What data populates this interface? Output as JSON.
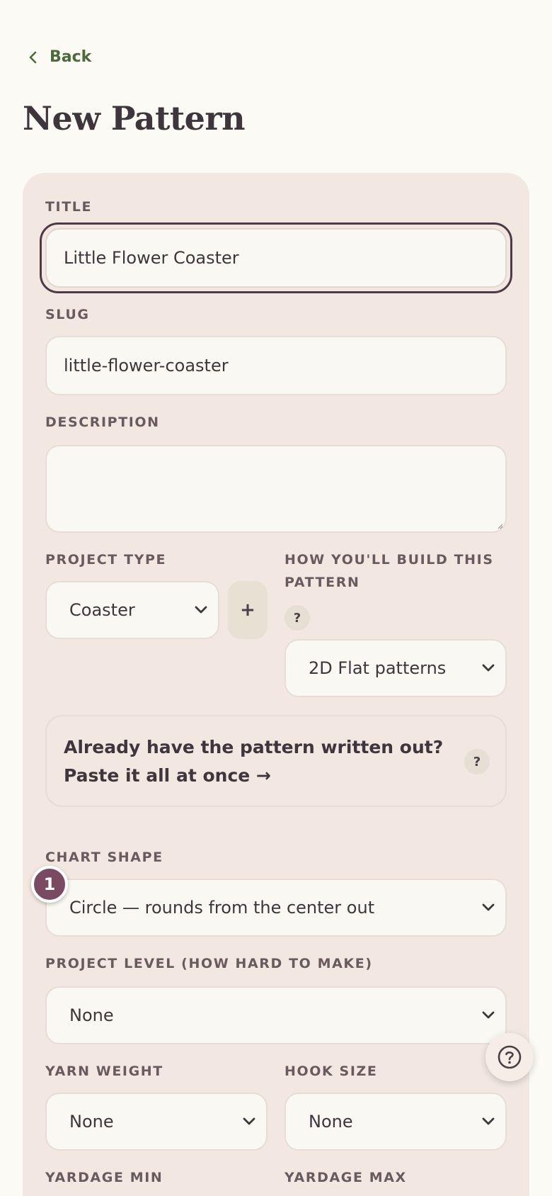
{
  "nav": {
    "back_label": "Back"
  },
  "page": {
    "title": "New Pattern"
  },
  "form": {
    "title_label": "TITLE",
    "title_value": "Little Flower Coaster",
    "slug_label": "SLUG",
    "slug_value": "little-flower-coaster",
    "description_label": "DESCRIPTION",
    "description_value": "",
    "project_type_label": "PROJECT TYPE",
    "project_type_value": "Coaster",
    "add_button": "+",
    "build_label_line1": "HOW YOU'LL BUILD THIS",
    "build_label_line2": "PATTERN",
    "build_help": "?",
    "build_value": "2D Flat patterns",
    "paste_line1": "Already have the pattern written out?",
    "paste_line2": "Paste it all at once →",
    "paste_help": "?",
    "chart_shape_label": "CHART SHAPE",
    "chart_shape_step": "1",
    "chart_shape_value": "Circle — rounds from the center out",
    "level_label": "PROJECT LEVEL (HOW HARD TO MAKE)",
    "level_value": "None",
    "yarn_weight_label": "YARN WEIGHT",
    "yarn_weight_value": "None",
    "hook_size_label": "HOOK SIZE",
    "hook_size_value": "None",
    "yardage_min_label": "YARDAGE MIN",
    "yardage_max_label": "YARDAGE MAX"
  },
  "colors": {
    "background": "#fcfaf4",
    "card": "#f3e7e1",
    "accent_green": "#4c6a3c",
    "step_badge": "#7a4a63",
    "text": "#3f363d"
  },
  "icons": {
    "back": "chevron-left-icon",
    "select": "chevron-down-icon",
    "help_fab": "question-circle-icon"
  }
}
